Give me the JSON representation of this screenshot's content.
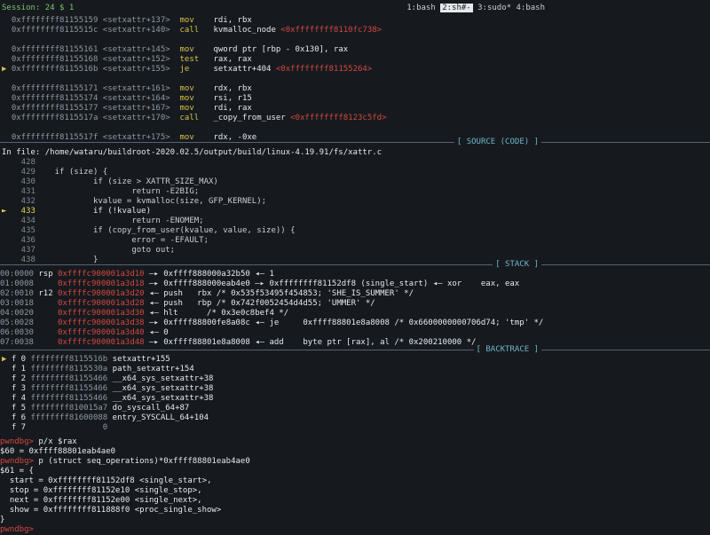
{
  "session": "Session: 24 $ 1",
  "tabs": [
    {
      "label": "1:bash",
      "active": false
    },
    {
      "label": "2:sh#-",
      "active": true
    },
    {
      "label": "3:sudo*",
      "active": false
    },
    {
      "label": "4:bash",
      "active": false
    }
  ],
  "disasm": [
    {
      "addr": "0xffffffff81155159",
      "sym": "<setxattr+137>",
      "op": "mov",
      "args": "rdi, rbx",
      "extra": "",
      "arrow": false
    },
    {
      "addr": "0xffffffff8115515c",
      "sym": "<setxattr+140>",
      "op": "call",
      "args": "kvmalloc_node",
      "extra": "<0xffffffff8110fc738>",
      "arrow": false
    },
    {
      "addr": "",
      "sym": "",
      "op": "",
      "args": "",
      "extra": "",
      "arrow": false
    },
    {
      "addr": "0xffffffff81155161",
      "sym": "<setxattr+145>",
      "op": "mov",
      "args": "qword ptr [rbp - 0x130], rax",
      "extra": "",
      "arrow": false
    },
    {
      "addr": "0xffffffff81155168",
      "sym": "<setxattr+152>",
      "op": "test",
      "args": "rax, rax",
      "extra": "",
      "arrow": false
    },
    {
      "addr": "0xffffffff8115516b",
      "sym": "<setxattr+155>",
      "op": "je",
      "args": "setxattr+404",
      "extra": "<0xffffffff81155264>",
      "arrow": true
    },
    {
      "addr": "",
      "sym": "",
      "op": "",
      "args": "",
      "extra": "",
      "arrow": false
    },
    {
      "addr": "0xffffffff81155171",
      "sym": "<setxattr+161>",
      "op": "mov",
      "args": "rdx, rbx",
      "extra": "",
      "arrow": false
    },
    {
      "addr": "0xffffffff81155174",
      "sym": "<setxattr+164>",
      "op": "mov",
      "args": "rsi, r15",
      "extra": "",
      "arrow": false
    },
    {
      "addr": "0xffffffff81155177",
      "sym": "<setxattr+167>",
      "op": "mov",
      "args": "rdi, rax",
      "extra": "",
      "arrow": false
    },
    {
      "addr": "0xffffffff8115517a",
      "sym": "<setxattr+170>",
      "op": "call",
      "args": "_copy_from_user",
      "extra": "<0xffffffff8123c5fd>",
      "arrow": false
    },
    {
      "addr": "",
      "sym": "",
      "op": "",
      "args": "",
      "extra": "",
      "arrow": false
    },
    {
      "addr": "0xffffffff8115517f",
      "sym": "<setxattr+175>",
      "op": "mov",
      "args": "rdx, -0xe",
      "extra": "",
      "arrow": false
    }
  ],
  "source_title": "[ SOURCE (CODE) ]",
  "source_file": "In file: /home/wataru/buildroot-2020.02.5/output/build/linux-4.19.91/fs/xattr.c",
  "source": [
    {
      "n": "428",
      "code": "",
      "cur": false
    },
    {
      "n": "429",
      "code": "  if (size) {",
      "cur": false
    },
    {
      "n": "430",
      "code": "          if (size > XATTR_SIZE_MAX)",
      "cur": false
    },
    {
      "n": "431",
      "code": "                  return -E2BIG;",
      "cur": false
    },
    {
      "n": "432",
      "code": "          kvalue = kvmalloc(size, GFP_KERNEL);",
      "cur": false
    },
    {
      "n": "433",
      "code": "          if (!kvalue)",
      "cur": true
    },
    {
      "n": "434",
      "code": "                  return -ENOMEM;",
      "cur": false
    },
    {
      "n": "435",
      "code": "          if (copy_from_user(kvalue, value, size)) {",
      "cur": false
    },
    {
      "n": "436",
      "code": "                  error = -EFAULT;",
      "cur": false
    },
    {
      "n": "437",
      "code": "                  goto out;",
      "cur": false
    },
    {
      "n": "438",
      "code": "          }",
      "cur": false
    }
  ],
  "stack_title": "[ STACK ]",
  "stack": [
    {
      "off": "00:0000",
      "reg": "rsp",
      "addr": "0xffffc900001a3d10",
      "rest": "—▸ 0xffff888000a32b50 ◂— 1"
    },
    {
      "off": "01:0008",
      "reg": "",
      "addr": "0xffffc900001a3d18",
      "rest": "—▸ 0xffff888000eab4e0 —▸ 0xffffffff81152df8 (single_start) ◂— xor    eax, eax"
    },
    {
      "off": "02:0010",
      "reg": "r12",
      "addr": "0xffffc900001a3d20",
      "rest": "◂— push   rbx /* 0x535f53495f454853; 'SHE_IS_SUMMER' */"
    },
    {
      "off": "03:0018",
      "reg": "",
      "addr": "0xffffc900001a3d28",
      "rest": "◂— push   rbp /* 0x742f0052454d4d55; 'UMMER' */"
    },
    {
      "off": "04:0020",
      "reg": "",
      "addr": "0xffffc900001a3d30",
      "rest": "◂— hlt      /* 0x3e0c8bef4 */"
    },
    {
      "off": "05:0028",
      "reg": "",
      "addr": "0xffffc900001a3d38",
      "rest": "—▸ 0xffff88800fe8a08c ◂— je     0xffff88801e8a8008 /* 0x6600000000706d74; 'tmp' */"
    },
    {
      "off": "06:0030",
      "reg": "",
      "addr": "0xffffc900001a3d40",
      "rest": "◂— 0"
    },
    {
      "off": "07:0038",
      "reg": "",
      "addr": "0xffffc900001a3d48",
      "rest": "—▸ 0xffff88801e8a8008 ◂— add    byte ptr [rax], al /* 0x200210000 */"
    }
  ],
  "backtrace_title": "[ BACKTRACE ]",
  "backtrace": [
    {
      "mark": "▶",
      "f": "f 0",
      "addr": "ffffffff8115516b",
      "sym": "setxattr+155"
    },
    {
      "mark": "",
      "f": "f 1",
      "addr": "ffffffff8115530a",
      "sym": "path_setxattr+154"
    },
    {
      "mark": "",
      "f": "f 2",
      "addr": "ffffffff81155466",
      "sym": "__x64_sys_setxattr+38"
    },
    {
      "mark": "",
      "f": "f 3",
      "addr": "ffffffff81155466",
      "sym": "__x64_sys_setxattr+38"
    },
    {
      "mark": "",
      "f": "f 4",
      "addr": "ffffffff81155466",
      "sym": "__x64_sys_setxattr+38"
    },
    {
      "mark": "",
      "f": "f 5",
      "addr": "ffffffff810015a7",
      "sym": "do_syscall_64+87"
    },
    {
      "mark": "",
      "f": "f 6",
      "addr": "ffffffff81600088",
      "sym": "entry_SYSCALL_64+104"
    },
    {
      "mark": "",
      "f": "f 7",
      "addr": "0",
      "sym": ""
    }
  ],
  "repl": [
    {
      "prompt": "pwndbg> ",
      "cmd": "p/x $rax"
    },
    {
      "prompt": "",
      "cmd": "$60 = 0xffff88801eab4ae0"
    },
    {
      "prompt": "pwndbg> ",
      "cmd": "p (struct seq_operations)*0xffff88801eab4ae0"
    },
    {
      "prompt": "",
      "cmd": "$61 = {"
    },
    {
      "prompt": "",
      "cmd": "  start = 0xffffffff81152df8 <single_start>,"
    },
    {
      "prompt": "",
      "cmd": "  stop = 0xffffffff81152e10 <single_stop>,"
    },
    {
      "prompt": "",
      "cmd": "  next = 0xffffffff81152e00 <single_next>,"
    },
    {
      "prompt": "",
      "cmd": "  show = 0xffffffff811888f0 <proc_single_show>"
    },
    {
      "prompt": "",
      "cmd": "}"
    },
    {
      "prompt": "pwndbg> ",
      "cmd": ""
    }
  ]
}
